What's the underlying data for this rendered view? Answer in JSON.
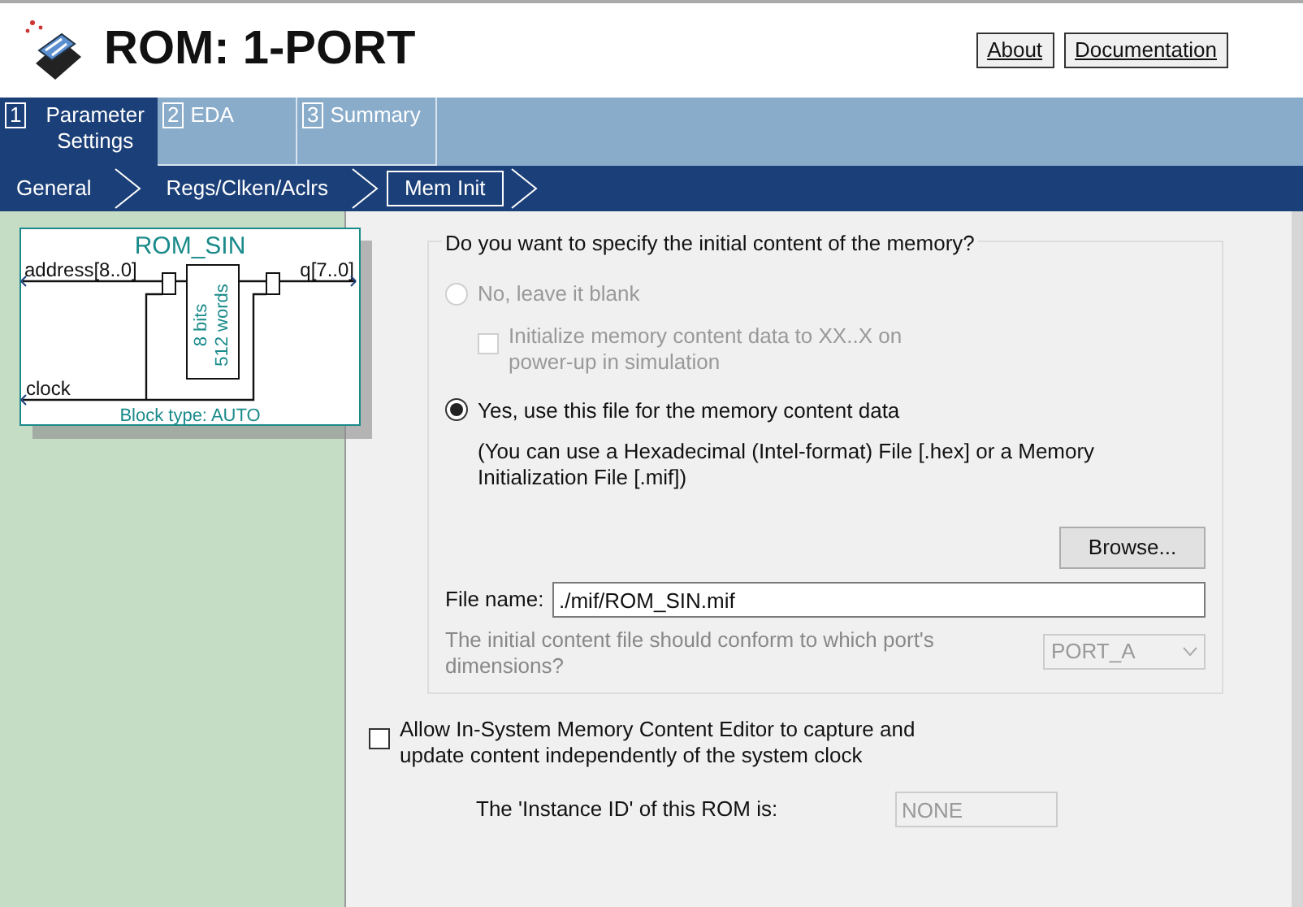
{
  "window": {
    "title": "ROM: 1-PORT"
  },
  "header_buttons": [
    {
      "label": "About"
    },
    {
      "label": "Documentation"
    }
  ],
  "tabs": [
    {
      "number": "1",
      "label": "Parameter Settings",
      "selected": true
    },
    {
      "number": "2",
      "label": "EDA",
      "selected": false
    },
    {
      "number": "3",
      "label": "Summary",
      "selected": false
    }
  ],
  "steps": [
    {
      "label": "General",
      "selected": false
    },
    {
      "label": "Regs/Clken/Aclrs",
      "selected": false
    },
    {
      "label": "Mem Init",
      "selected": true
    }
  ],
  "symbol": {
    "name": "ROM_SIN",
    "input": "address[8..0]",
    "output": "q[7..0]",
    "clock": "clock",
    "width": "8 bits",
    "depth": "512 words",
    "block_type": "Block type: AUTO"
  },
  "memory_content": {
    "title": "Do you want to specify the initial content of the memory?",
    "options": [
      {
        "label": "No, leave it blank",
        "selected": false,
        "disabled": true
      },
      {
        "label": "Yes, use this file for the memory content data",
        "selected": true,
        "disabled": false
      }
    ],
    "init_checkbox": {
      "label": "Initialize memory content data to XX..X on power-up in simulation",
      "checked": false,
      "disabled": true
    },
    "hint": "(You can use a Hexadecimal (Intel-format) File [.hex] or a Memory Initialization File [.mif])",
    "browse_button": "Browse...",
    "file_label": "File name:",
    "file_value": "./mif/ROM_SIN.mif",
    "port_question": "The initial content file should conform to which port's dimensions?",
    "port_select": {
      "value": "PORT_A",
      "disabled": true
    }
  },
  "editor_checkbox": {
    "label": "Allow In-System Memory Content Editor to capture and update content independently of the system clock",
    "checked": false
  },
  "instance_id": {
    "label": "The 'Instance ID' of this ROM is:",
    "value": "NONE",
    "disabled": true
  }
}
